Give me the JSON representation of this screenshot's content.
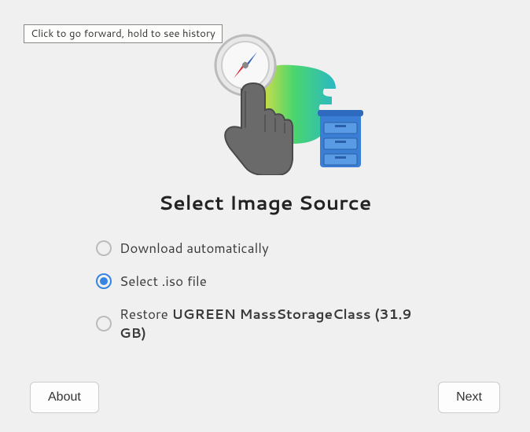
{
  "tooltip": "Click to go forward, hold to see history",
  "title": "Select Image Source",
  "options": {
    "download": {
      "label": "Download automatically",
      "selected": false
    },
    "selectIso": {
      "label": "Select .iso file",
      "selected": true
    },
    "restore": {
      "label_prefix": "Restore ",
      "label_bold": "UGREEN MassStorageClass (31.9 GB)",
      "selected": false
    }
  },
  "buttons": {
    "about": "About",
    "next": "Next"
  }
}
